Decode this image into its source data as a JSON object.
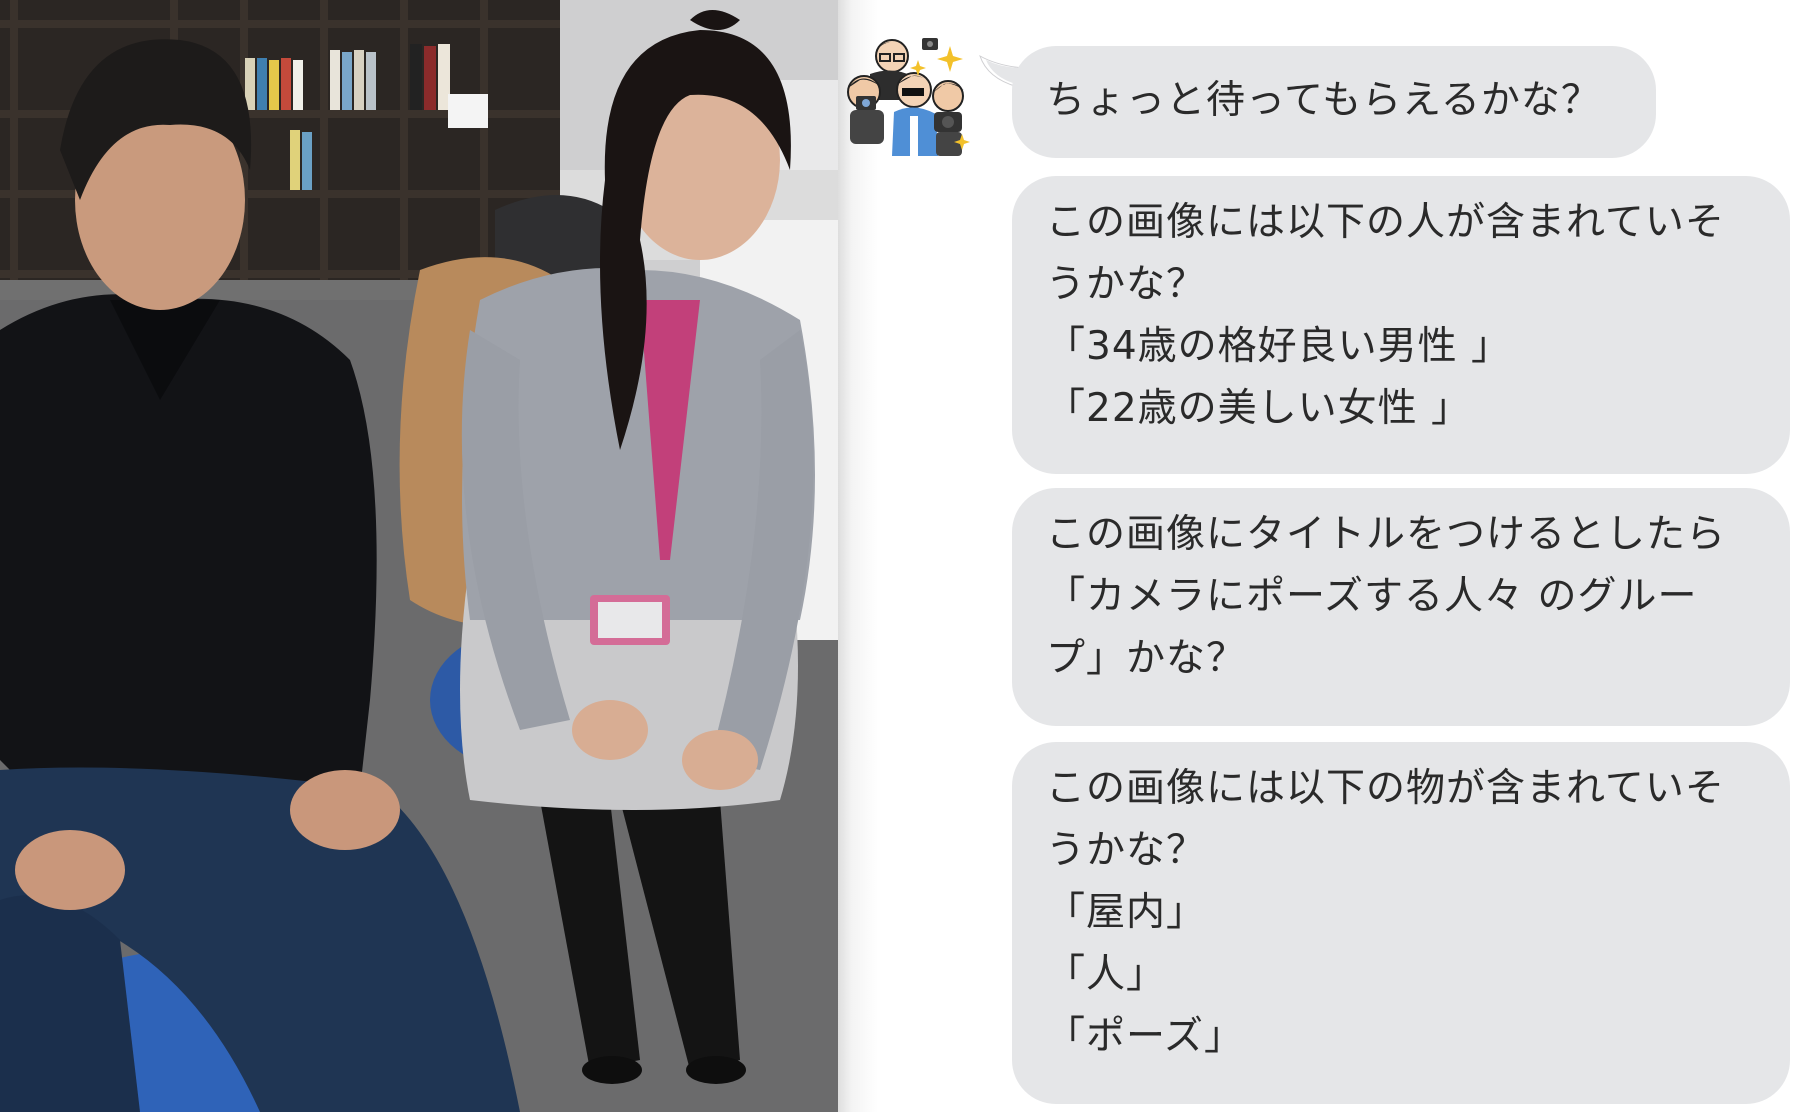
{
  "photo": {
    "description_icon": "office-photo"
  },
  "chat": {
    "avatar_icon": "paparazzi-illustration-icon",
    "bubble_color": "#e5e6e8",
    "text_color": "#2a2a2a",
    "messages": [
      {
        "lines": [
          "ちょっと待ってもらえるかな？"
        ]
      },
      {
        "lines": [
          "この画像には以下の人が含まれていそ",
          "うかな？",
          "「34歳の格好良い男性 」",
          "「22歳の美しい女性 」"
        ]
      },
      {
        "lines": [
          "この画像にタイトルをつけるとしたら",
          "「カメラにポーズする人々 のグルー",
          "プ」かな？"
        ]
      },
      {
        "lines": [
          "この画像には以下の物が含まれていそ",
          "うかな？",
          "「屋内」",
          "「人」",
          "「ポーズ」"
        ]
      }
    ]
  }
}
